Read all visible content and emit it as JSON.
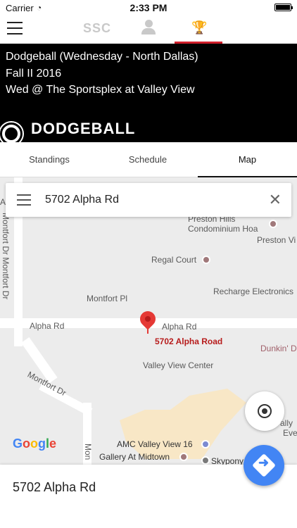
{
  "status": {
    "carrier": "Carrier",
    "time": "2:33 PM"
  },
  "nav": {
    "logo_text": "SSC"
  },
  "header": {
    "line1": "Dodgeball (Wednesday - North Dallas)",
    "line2": "Fall II 2016",
    "line3": "Wed @ The Sportsplex at Valley View",
    "brand": "DODGEBALL"
  },
  "tabs": [
    {
      "label": "Standings"
    },
    {
      "label": "Schedule"
    },
    {
      "label": "Map"
    }
  ],
  "map": {
    "search_value": "5702 Alpha Rd",
    "labels": {
      "preston_hills": "Preston Hills",
      "condominium": "Condominium Hoa",
      "preston_vi": "Preston Vi",
      "regal": "Regal Court",
      "montfort_pl": "Montfort Pl",
      "recharge": "Recharge Electronics",
      "alpha_left": "Alpha Rd",
      "alpha_right": "Alpha Rd",
      "pin_label": "5702 Alpha Road",
      "dunkin": "Dunkin' D",
      "valley_view": "Valley View Center",
      "amc": "AMC Valley View 16",
      "gallery": "Gallery At Midtown",
      "skypony": "Skypony",
      "montfort_dr": "Montfort Dr",
      "montfort_dr_vertical": "Montfort Dr Montfort Dr",
      "mon_vertical": "Mon",
      "ally": "ally",
      "eve": "Eve",
      "ai": "Ai"
    },
    "google": {
      "g": "G",
      "o1": "o",
      "o2": "o",
      "g2": "g",
      "l": "l",
      "e": "e"
    }
  },
  "bottom": {
    "address": "5702 Alpha Rd"
  },
  "colors": {
    "accent": "#d01f2b",
    "primary_blue": "#4285f4",
    "pin_red": "#e53935"
  }
}
